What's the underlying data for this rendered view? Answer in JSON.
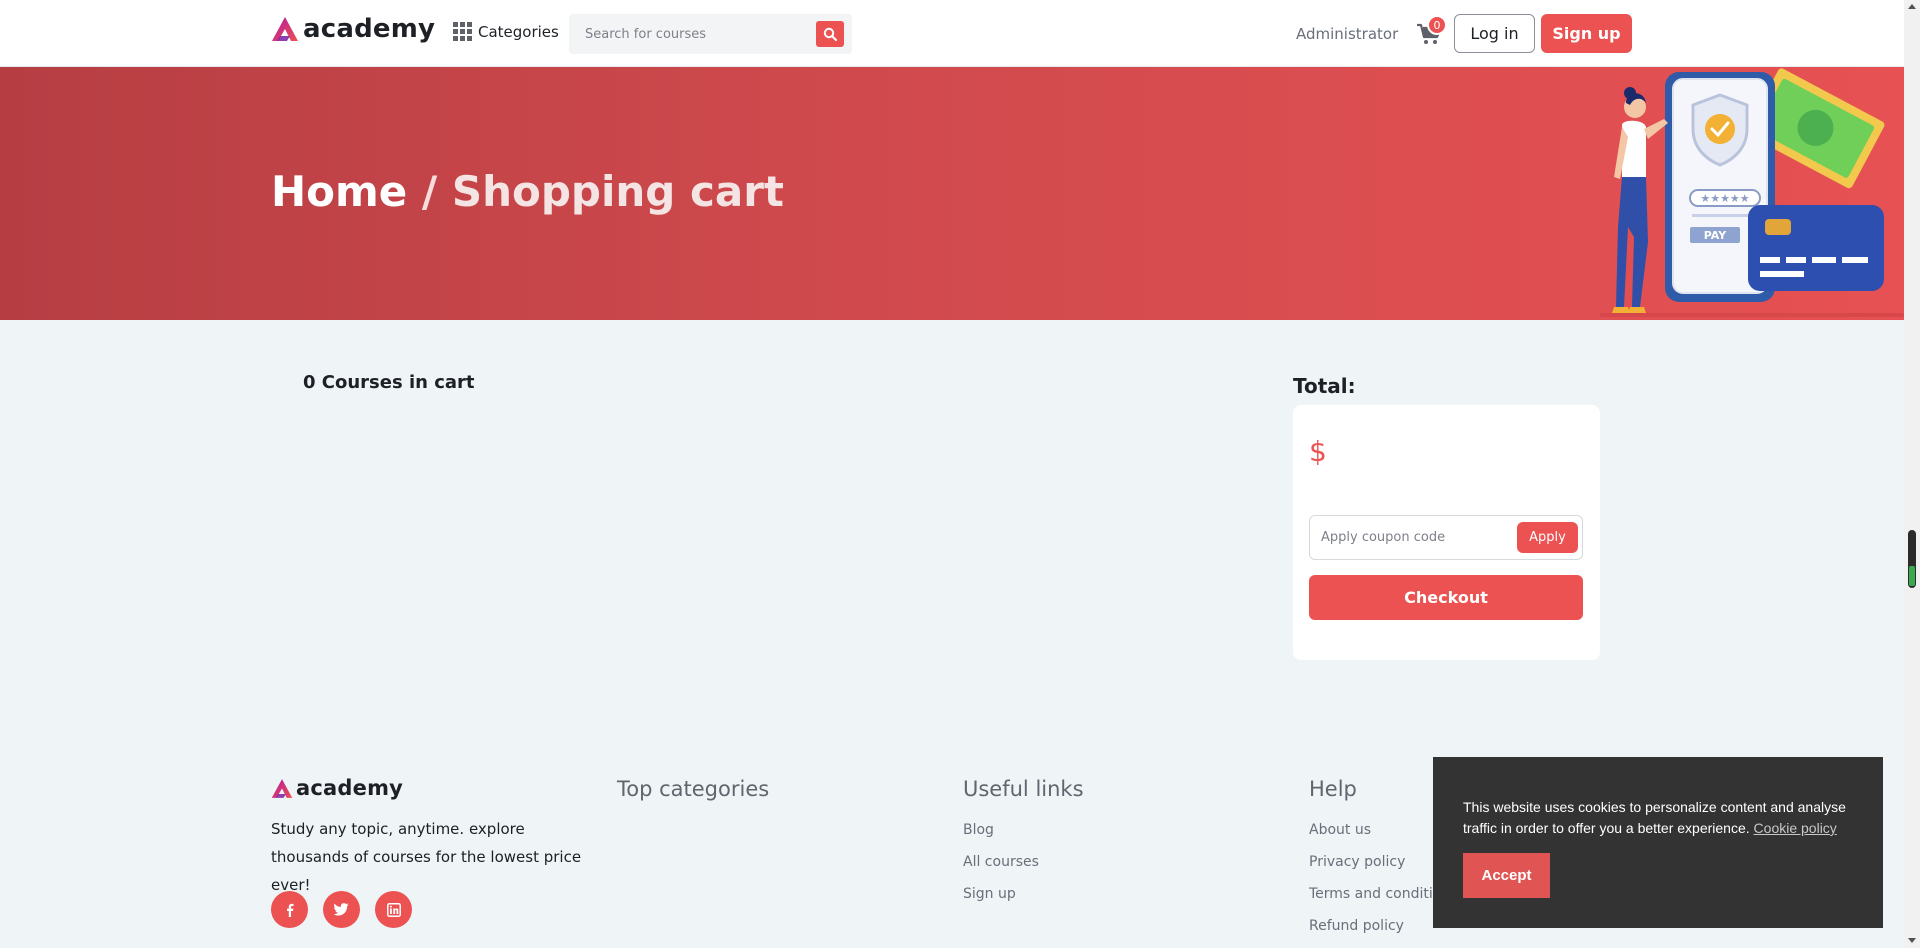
{
  "header": {
    "brand": "academy",
    "categories_label": "Categories",
    "search_placeholder": "Search for courses",
    "admin_label": "Administrator",
    "cart_count": "0",
    "login_label": "Log in",
    "signup_label": "Sign up"
  },
  "hero": {
    "home": "Home",
    "separator": "/",
    "current": "Shopping cart"
  },
  "cart": {
    "count_label": "0 Courses in cart",
    "total_label": "Total:",
    "total_price": "$",
    "coupon_placeholder": "Apply coupon code",
    "apply_label": "Apply",
    "checkout_label": "Checkout"
  },
  "footer": {
    "brand": "academy",
    "description": "Study any topic, anytime. explore thousands of courses for the lowest price ever!",
    "top_categories_title": "Top categories",
    "useful_links_title": "Useful links",
    "useful_links": [
      "Blog",
      "All courses",
      "Sign up"
    ],
    "help_title": "Help",
    "help_links": [
      "About us",
      "Privacy policy",
      "Terms and condition",
      "Refund policy"
    ],
    "socials": [
      "facebook-icon",
      "twitter-icon",
      "linkedin-icon"
    ]
  },
  "cookie": {
    "message": "This website uses cookies to personalize content and analyse traffic in order to offer you a better experience.",
    "policy_link": "Cookie policy",
    "accept_label": "Accept"
  },
  "colors": {
    "accent": "#ec5252",
    "hero_start": "#b63e43",
    "hero_end": "#e75153",
    "background": "#eff4f7",
    "cookie_bg": "#333333"
  }
}
